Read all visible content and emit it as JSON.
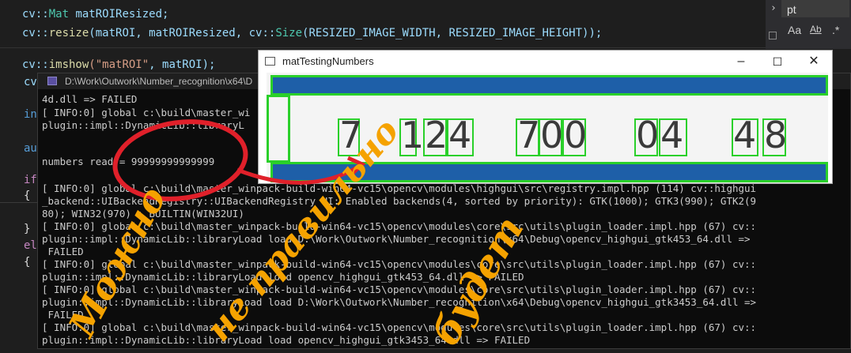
{
  "editor": {
    "line1": {
      "kw": "cv::",
      "type": "Mat",
      "rest": " matROIResized;"
    },
    "line2": {
      "ns": "cv::",
      "fn": "resize",
      "args": "(matROI, matROIResized, cv::",
      "type": "Size",
      "rest": "(RESIZED_IMAGE_WIDTH, RESIZED_IMAGE_HEIGHT));"
    },
    "line3": {
      "ns": "cv::",
      "fn": "imshow",
      "str": "(\"matROI\"",
      "rest": ", matROI);"
    },
    "partials": [
      "cv",
      "int",
      "aut",
      "if",
      "{",
      "}",
      "els",
      "{"
    ]
  },
  "find": {
    "value": "pt",
    "opt_case": "Aa",
    "opt_word": "Ab",
    "opt_regex": ".*"
  },
  "console": {
    "title": "D:\\Work\\Outwork\\Number_recognition\\x64\\D",
    "lines": [
      "4d.dll => FAILED",
      "[ INFO:0] global c:\\build\\master_wi",
      "plugin::impl::DynamicLib::libraryL",
      "",
      "numbers read = 99999999999999",
      "",
      "[ INFO:0] global c:\\build\\master_winpack-build-win64-vc15\\opencv\\modules\\highgui\\src\\registry.impl.hpp (114) cv::highgui",
      "_backend::UIBackendRegistry::UIBackendRegistry UI: Enabled backends(4, sorted by priority): GTK(1000); GTK3(990); GTK2(9",
      "80); WIN32(970) + BUILTIN(WIN32UI)",
      "[ INFO:0] global c:\\build\\master_winpack-build-win64-vc15\\opencv\\modules\\core\\src\\utils\\plugin_loader.impl.hpp (67) cv::",
      "plugin::impl::DynamicLib::libraryLoad load D:\\Work\\Outwork\\Number_recognition\\x64\\Debug\\opencv_highgui_gtk453_64.dll =>",
      " FAILED",
      "[ INFO:0] global c:\\build\\master_winpack-build-win64-vc15\\opencv\\modules\\core\\src\\utils\\plugin_loader.impl.hpp (67) cv::",
      "plugin::impl::DynamicLib::libraryLoad load opencv_highgui_gtk453_64.dll => FAILED",
      "[ INFO:0] global c:\\build\\master_winpack-build-win64-vc15\\opencv\\modules\\core\\src\\utils\\plugin_loader.impl.hpp (67) cv::",
      "plugin::impl::DynamicLib::libraryLoad load D:\\Work\\Outwork\\Number_recognition\\x64\\Debug\\opencv_highgui_gtk3453_64.dll =>",
      " FAILED",
      "[ INFO:0] global c:\\build\\master_winpack-build-win64-vc15\\opencv\\modules\\core\\src\\utils\\plugin_loader.impl.hpp (67) cv::",
      "plugin::impl::DynamicLib::libraryLoad load opencv_highgui_gtk3453_64.dll => FAILED"
    ]
  },
  "image_window": {
    "title": "matTestingNumbers",
    "btn_min": "–",
    "btn_max": "☐",
    "btn_close": "✕",
    "digits": [
      "7",
      "1",
      "2",
      "4",
      "7",
      "0",
      "0",
      "0",
      "4",
      "4",
      "8"
    ]
  },
  "annotation": {
    "words": [
      "Можно",
      "не правильно",
      "будет"
    ],
    "color_orange": "#f5a200",
    "color_red": "#e0202a"
  },
  "colors": {
    "box_green": "#2ad02a",
    "bar_blue": "#1e5fa8"
  }
}
